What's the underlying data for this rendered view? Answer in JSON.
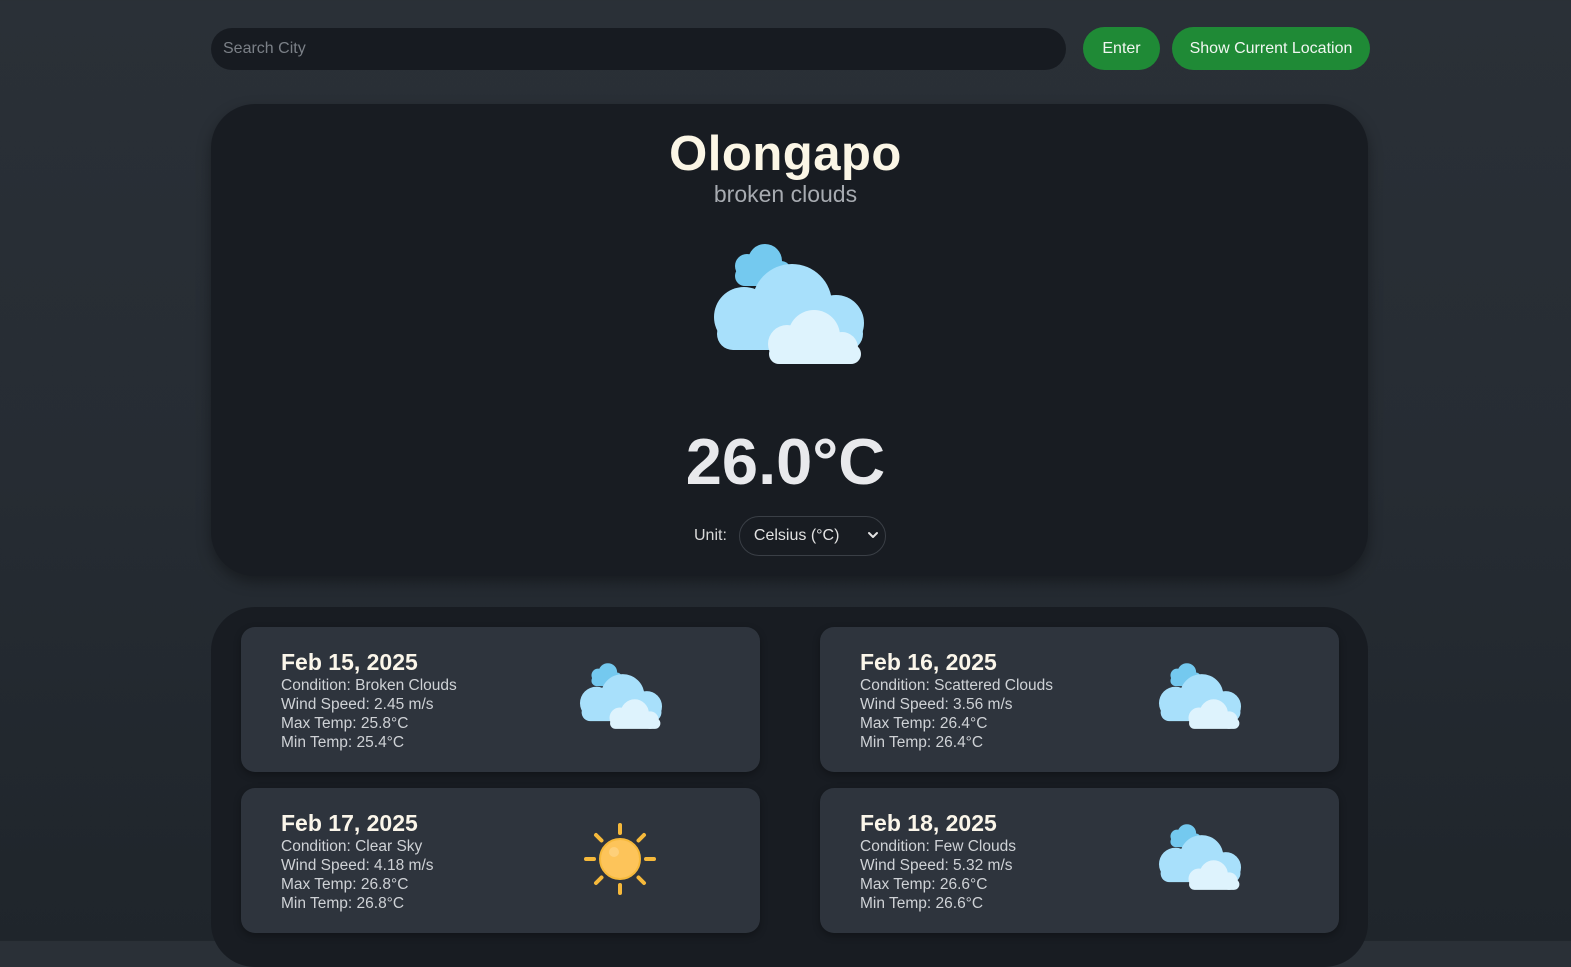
{
  "search": {
    "placeholder": "Search City",
    "value": ""
  },
  "buttons": {
    "enter_label": "Enter",
    "location_label": "Show Current Location"
  },
  "current": {
    "city": "Olongapo",
    "description": "broken clouds",
    "icon": "broken-clouds-icon",
    "temperature": "26.0°C",
    "unit_label": "Unit:",
    "unit_selected": "Celsius (°C)"
  },
  "forecast": [
    {
      "date": "Feb 15, 2025",
      "condition": "Condition: Broken Clouds",
      "wind": "Wind Speed: 2.45 m/s",
      "max": "Max Temp: 25.8°C",
      "min": "Min Temp: 25.4°C",
      "icon": "broken-clouds-icon"
    },
    {
      "date": "Feb 16, 2025",
      "condition": "Condition: Scattered Clouds",
      "wind": "Wind Speed: 3.56 m/s",
      "max": "Max Temp: 26.4°C",
      "min": "Min Temp: 26.4°C",
      "icon": "scattered-clouds-icon"
    },
    {
      "date": "Feb 17, 2025",
      "condition": "Condition: Clear Sky",
      "wind": "Wind Speed: 4.18 m/s",
      "max": "Max Temp: 26.8°C",
      "min": "Min Temp: 26.8°C",
      "icon": "sun-icon"
    },
    {
      "date": "Feb 18, 2025",
      "condition": "Condition: Few Clouds",
      "wind": "Wind Speed: 5.32 m/s",
      "max": "Max Temp: 26.6°C",
      "min": "Min Temp: 26.6°C",
      "icon": "few-clouds-icon"
    }
  ],
  "colors": {
    "accent_green": "#1f8a36",
    "card_dark": "#181c22",
    "forecast_card": "#2e343d",
    "city_text": "#fbf6e6"
  }
}
